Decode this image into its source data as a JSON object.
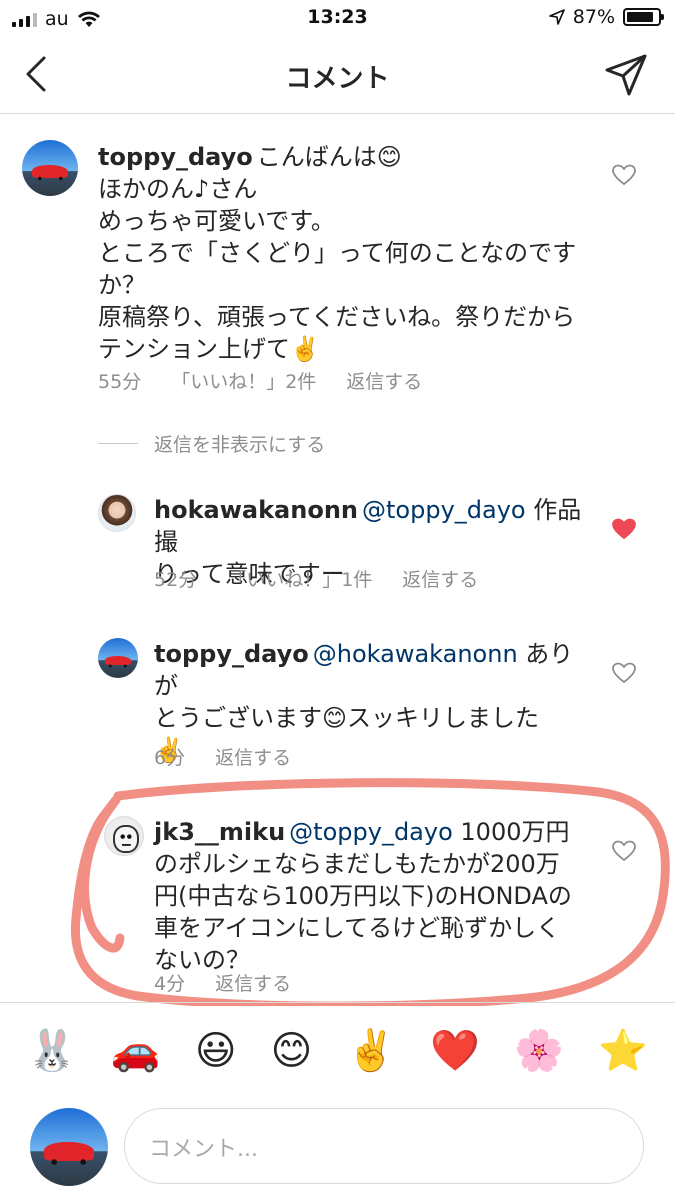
{
  "status_bar": {
    "carrier": "au",
    "time": "13:23",
    "battery_text": "87%",
    "battery_level": 0.87
  },
  "header": {
    "title": "コメント"
  },
  "comments": [
    {
      "username": "toppy_dayo",
      "lines": [
        "こんばんは😊",
        "ほかのん♪さん",
        "めっちゃ可愛いです。",
        "ところで「さくどり」って何のことなのです",
        "か？",
        "原稿祭り、頑張ってくださいね。祭りだから",
        "テンション上げて✌️"
      ],
      "time": "55分",
      "likes": "「いいね！」2件",
      "reply": "返信する",
      "liked": false
    }
  ],
  "hide_replies_label": "返信を非表示にする",
  "replies": [
    {
      "username": "hokawakanonn",
      "mention": "@toppy_dayo",
      "line1": "作品撮",
      "line2": "りって意味ですー",
      "time": "52分",
      "likes": "「いいね！」1件",
      "reply": "返信する",
      "liked": true
    },
    {
      "username": "toppy_dayo",
      "mention": "@hokawakanonn",
      "line1": "ありが",
      "line2": "とうございます😊スッキリしました",
      "line3": "✌️",
      "time": "6分",
      "reply": "返信する",
      "liked": false
    },
    {
      "username": "jk3__miku",
      "mention": "@toppy_dayo",
      "line1": "1000万円",
      "line2": "のポルシェならまだしもたかが200万",
      "line3": "円(中古なら100万円以下)のHONDAの",
      "line4": "車をアイコンにしてるけど恥ずかしく",
      "line5": "ないの？",
      "time": "4分",
      "reply": "返信する",
      "liked": false
    }
  ],
  "emoji_bar": [
    "🐰",
    "🚗",
    "😃",
    "😊",
    "✌️",
    "❤️",
    "🌸",
    "⭐"
  ],
  "input": {
    "placeholder": "コメント..."
  },
  "colors": {
    "heart_liked": "#ed4956",
    "heart_outline": "#8e8e8e",
    "mention": "#003569",
    "annotation": "#f07b6e"
  }
}
